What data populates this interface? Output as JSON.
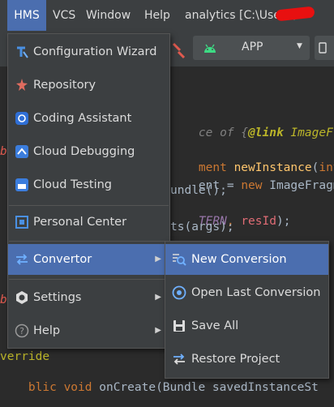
{
  "menubar": {
    "items": [
      "HMS",
      "VCS",
      "Window",
      "Help"
    ],
    "project": "analytics [C:\\Users\\s"
  },
  "toolbar": {
    "run_config": "APP"
  },
  "hms_menu": {
    "items": [
      {
        "label": "Configuration Wizard",
        "icon": "configuration-wizard-icon"
      },
      {
        "label": "Repository",
        "icon": "repository-icon"
      },
      {
        "label": "Coding Assistant",
        "icon": "coding-assistant-icon"
      },
      {
        "label": "Cloud Debugging",
        "icon": "cloud-debugging-icon"
      },
      {
        "label": "Cloud Testing",
        "icon": "cloud-testing-icon"
      },
      {
        "label": "Personal Center",
        "icon": "personal-center-icon"
      },
      {
        "label": "Convertor",
        "icon": "convertor-icon"
      },
      {
        "label": "Settings",
        "icon": "settings-icon"
      },
      {
        "label": "Help",
        "icon": "help-icon"
      }
    ]
  },
  "convertor_submenu": {
    "items": [
      {
        "label": "New Conversion",
        "icon": "new-conversion-icon"
      },
      {
        "label": "Open Last Conversion",
        "icon": "open-last-conversion-icon"
      },
      {
        "label": "Save All",
        "icon": "save-icon"
      },
      {
        "label": "Restore Project",
        "icon": "restore-project-icon"
      }
    ]
  },
  "code": {
    "l1a": "ce of {",
    "l1b": "@link",
    "l1c": " ImageFra",
    "l2a": "ment ",
    "l2b": "newInstance",
    "l2c": "(",
    "l2d": "int",
    "l3a": "ent = ",
    "l3b": "new",
    "l3c": " ImageFragme",
    "l4": "undle();",
    "l5a": "TERN",
    "l5b": ", ",
    "l5c": "resId",
    "l5d": ");",
    "l6": "ts(args);",
    "l7": "verride",
    "l8a": "blic ",
    "l8b": "void ",
    "l8c": "onCreate(Bundle savedInstanceSt",
    "margin_b": "b"
  },
  "colors": {
    "highlight": "#4b6eaf",
    "menu_bg": "#3c3f41",
    "editor_bg": "#2b2b2b",
    "keyword": "#cc7832",
    "annotation": "#bbb529",
    "method": "#ffc66d",
    "field": "#9876aa",
    "param": "#e06c75",
    "comment": "#808080"
  }
}
